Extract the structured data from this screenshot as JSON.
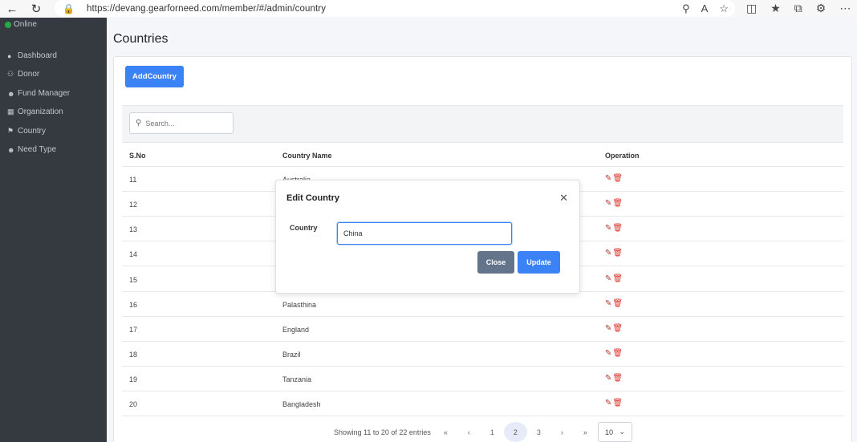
{
  "browser": {
    "url": "https://devang.gearforneed.com/member/#/admin/country"
  },
  "sidebar": {
    "status": "Online",
    "items": [
      {
        "label": "Dashboard",
        "icon": "palette-icon"
      },
      {
        "label": "Donor",
        "icon": "users-icon"
      },
      {
        "label": "Fund Manager",
        "icon": "user-icon"
      },
      {
        "label": "Organization",
        "icon": "sitemap-icon"
      },
      {
        "label": "Country",
        "icon": "flag-icon"
      },
      {
        "label": "Need Type",
        "icon": "user-icon"
      }
    ]
  },
  "page": {
    "title": "Countries",
    "add_button": "AddCountry",
    "search_placeholder": "Search..."
  },
  "table": {
    "headers": [
      "S.No",
      "Country Name",
      "Operation"
    ],
    "rows": [
      {
        "sno": "11",
        "name": "Australia"
      },
      {
        "sno": "12",
        "name": ""
      },
      {
        "sno": "13",
        "name": ""
      },
      {
        "sno": "14",
        "name": ""
      },
      {
        "sno": "15",
        "name": ""
      },
      {
        "sno": "16",
        "name": "Palasthina"
      },
      {
        "sno": "17",
        "name": "England"
      },
      {
        "sno": "18",
        "name": "Brazil"
      },
      {
        "sno": "19",
        "name": "Tanzania"
      },
      {
        "sno": "20",
        "name": "Bangladesh"
      }
    ]
  },
  "pagination": {
    "summary": "Showing 11 to 20 of 22 entries",
    "first": "«",
    "prev": "‹",
    "pages": [
      "1",
      "2",
      "3"
    ],
    "current": "2",
    "next": "›",
    "last": "»",
    "page_size": "10"
  },
  "modal": {
    "title": "Edit Country",
    "field_label": "Country",
    "field_value": "China",
    "close_label": "Close",
    "update_label": "Update"
  },
  "colors": {
    "sidebar": "#343a40",
    "primary": "#3b82f6",
    "secondary": "#64748b",
    "danger_icon": "#e0342b"
  }
}
